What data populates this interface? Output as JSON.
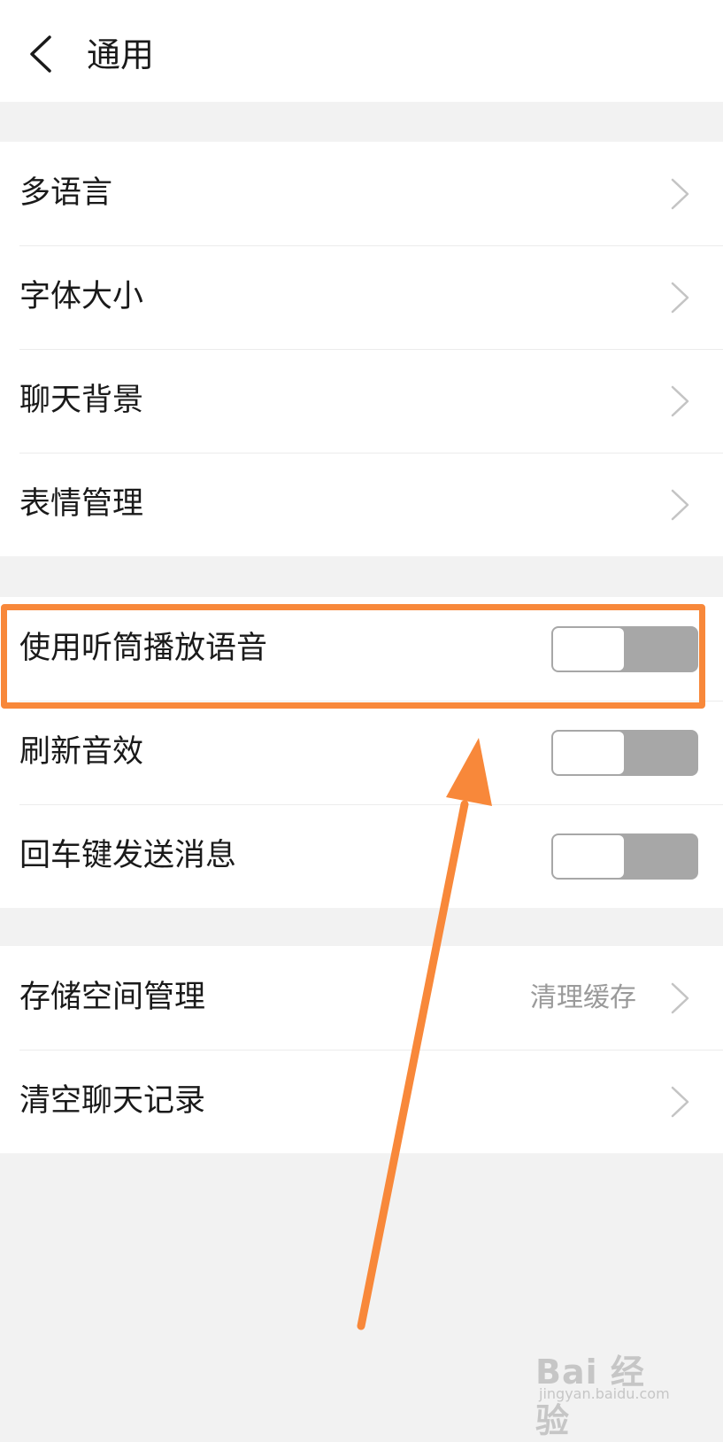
{
  "header": {
    "title": "通用",
    "back_icon": "chevron-left-icon"
  },
  "group_display": {
    "items": [
      {
        "label": "多语言"
      },
      {
        "label": "字体大小"
      },
      {
        "label": "聊天背景"
      },
      {
        "label": "表情管理"
      }
    ]
  },
  "group_sound": {
    "items": [
      {
        "label": "使用听筒播放语音",
        "toggle_on": false
      },
      {
        "label": "刷新音效",
        "toggle_on": false
      },
      {
        "label": "回车键发送消息",
        "toggle_on": false
      }
    ]
  },
  "group_storage": {
    "items": [
      {
        "label": "存储空间管理",
        "value": "清理缓存"
      },
      {
        "label": "清空聊天记录"
      }
    ]
  },
  "watermark": {
    "logo": "Bai 经验",
    "url": "jingyan.baidu.com"
  },
  "colors": {
    "annotation": "#f8883a",
    "toggle_off": "#a7a7a7",
    "secondary_text": "#9a9a9a"
  }
}
